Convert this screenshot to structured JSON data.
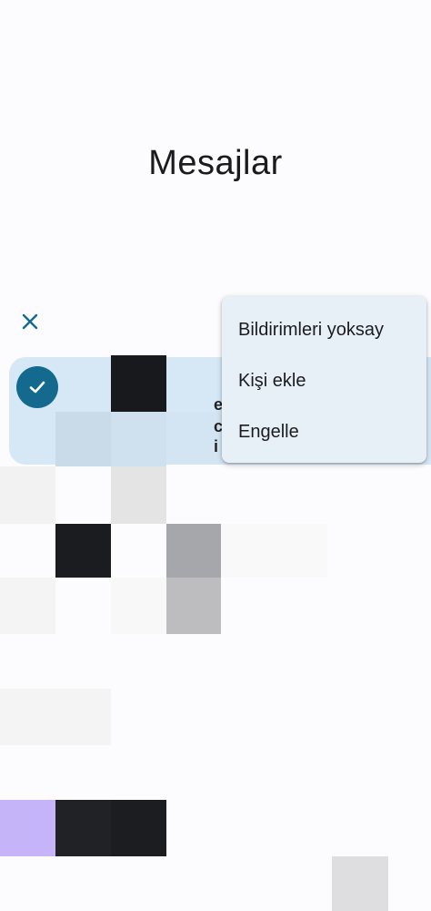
{
  "header": {
    "title": "Mesajlar"
  },
  "toolbar": {
    "close_icon": "close-icon"
  },
  "selection": {
    "check_icon": "check-icon"
  },
  "context_menu": {
    "items": [
      {
        "label": "Bildirimleri yoksay"
      },
      {
        "label": "Kişi ekle"
      },
      {
        "label": "Engelle"
      }
    ]
  },
  "row": {
    "partial_glyphs": [
      "ey",
      "c",
      "i"
    ]
  },
  "colors": {
    "accent": "#136a8e",
    "selected_bg": "#d6e8f6",
    "menu_bg": "#e8f0f7",
    "avatar_purple": "#c6b4f8"
  }
}
